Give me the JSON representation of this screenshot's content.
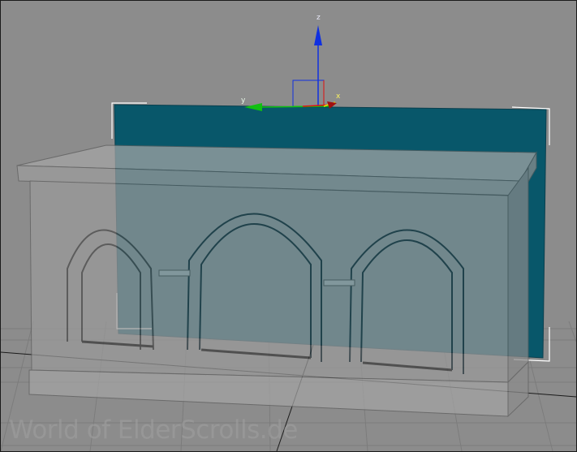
{
  "viewport": {
    "background_color": "#8c8c8c",
    "grid_color": "#7a7a7a",
    "grid_axis_color": "#1a1a1a"
  },
  "gizmo": {
    "z_label": "z",
    "y_label": "y",
    "x_label": "x",
    "z_color": "#1030e0",
    "y_color": "#10c010",
    "x_color": "#e01010",
    "highlight_color": "#f0e000"
  },
  "plane": {
    "color": "#08576a",
    "selection_bracket_color": "#ffffff"
  },
  "model": {
    "wall_color": "#9a9a9a",
    "edge_color": "#5e5e5e"
  },
  "watermark": {
    "text": "World of ElderScrolls.de"
  }
}
